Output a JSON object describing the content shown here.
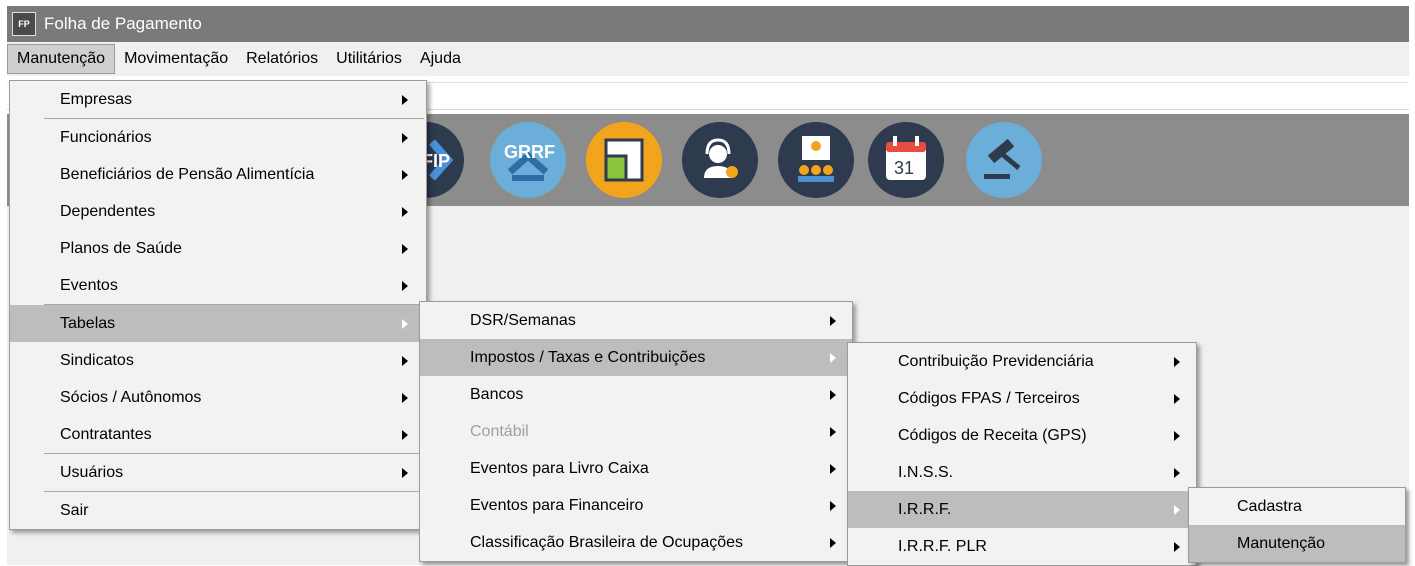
{
  "window": {
    "title": "Folha de Pagamento",
    "icon_text": "FP"
  },
  "menubar": {
    "items": [
      {
        "label": "Manutenção"
      },
      {
        "label": "Movimentação"
      },
      {
        "label": "Relatórios"
      },
      {
        "label": "Utilitários"
      },
      {
        "label": "Ajuda"
      }
    ]
  },
  "toolbar": {
    "icons": [
      {
        "name": "sefip-icon",
        "text": "EFIP",
        "color": "#2e3b4e"
      },
      {
        "name": "grrf-icon",
        "text": "GRRF",
        "color": "#5ea6d4"
      },
      {
        "name": "document-icon",
        "color": "#f2a51c"
      },
      {
        "name": "support-agent-icon",
        "color": "#2e3b4e"
      },
      {
        "name": "meeting-icon",
        "color": "#2e3b4e"
      },
      {
        "name": "calendar-icon",
        "text": "31",
        "color": "#2e3b4e"
      },
      {
        "name": "gavel-icon",
        "color": "#5ea6d4"
      }
    ]
  },
  "menu_manutencao": {
    "items": [
      {
        "label": "Empresas"
      },
      {
        "label": "Funcionários"
      },
      {
        "label": "Beneficiários de Pensão Alimentícia"
      },
      {
        "label": "Dependentes"
      },
      {
        "label": "Planos de Saúde"
      },
      {
        "label": "Eventos"
      },
      {
        "label": "Tabelas"
      },
      {
        "label": "Sindicatos"
      },
      {
        "label": "Sócios / Autônomos"
      },
      {
        "label": "Contratantes"
      },
      {
        "label": "Usuários"
      },
      {
        "label": "Sair"
      }
    ]
  },
  "menu_tabelas": {
    "items": [
      {
        "label": "DSR/Semanas"
      },
      {
        "label": "Impostos / Taxas e Contribuições"
      },
      {
        "label": "Bancos"
      },
      {
        "label": "Contábil"
      },
      {
        "label": "Eventos para Livro Caixa"
      },
      {
        "label": "Eventos para Financeiro"
      },
      {
        "label": "Classificação Brasileira de Ocupações"
      }
    ]
  },
  "menu_impostos": {
    "items": [
      {
        "label": "Contribuição Previdenciária"
      },
      {
        "label": "Códigos FPAS / Terceiros"
      },
      {
        "label": "Códigos de Receita (GPS)"
      },
      {
        "label": "I.N.S.S."
      },
      {
        "label": "I.R.R.F."
      },
      {
        "label": "I.R.R.F. PLR"
      }
    ]
  },
  "menu_irrf": {
    "items": [
      {
        "label": "Cadastra"
      },
      {
        "label": "Manutenção"
      }
    ]
  }
}
